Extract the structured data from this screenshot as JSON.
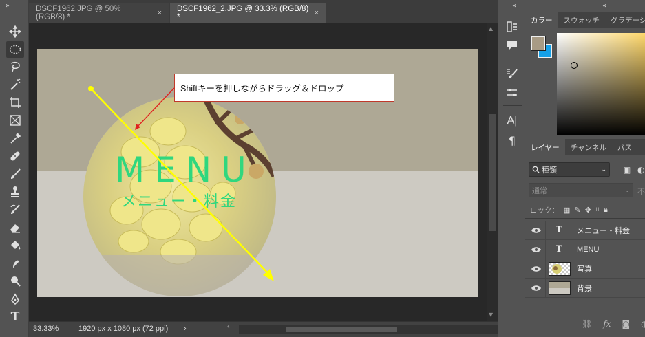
{
  "app": {
    "tabs": [
      {
        "label": "DSCF1962.JPG @ 50% (RGB/8) *",
        "close": "×"
      },
      {
        "label": "DSCF1962_2.JPG @ 33.3% (RGB/8) *",
        "close": "×"
      }
    ]
  },
  "toolbar": {
    "tools": [
      "move-tool-icon",
      "elliptical-marquee-icon",
      "lasso-icon",
      "magic-wand-icon",
      "crop-icon",
      "frame-icon",
      "eyedropper-icon",
      "healing-brush-icon",
      "brush-icon",
      "clone-stamp-icon",
      "history-brush-icon",
      "eraser-icon",
      "paint-bucket-icon",
      "smudge-icon",
      "dodge-icon",
      "pen-icon",
      "type-icon"
    ],
    "type_glyph": "T"
  },
  "canvas": {
    "menu_text": "MENU",
    "sub_text": "メニュー・料金",
    "text_color": "#2fd77e",
    "background_top": "#aea895",
    "background_bottom": "#cdcac2"
  },
  "callout": {
    "text": "Shiftキーを押しながらドラッグ＆ドロップ"
  },
  "status": {
    "zoom": "33.33%",
    "doc_info": "1920 px x 1080 px (72 ppi)",
    "arrow": "›",
    "scroll_left": "‹"
  },
  "midstrip": {
    "text_icon": "A|",
    "para_icon": "¶"
  },
  "color_panel": {
    "tabs": [
      "カラー",
      "スウォッチ",
      "グラデーション"
    ],
    "foreground": "#a89b85",
    "background": "#15a0e8"
  },
  "layers_panel": {
    "tabs": [
      "レイヤー",
      "チャンネル",
      "パス"
    ],
    "filter_label": "種類",
    "blend_mode": "通常",
    "opacity_label": "不",
    "lock_label": "ロック：",
    "layers": [
      {
        "name": "メニュー・料金",
        "kind": "text",
        "type_glyph": "T"
      },
      {
        "name": "MENU",
        "kind": "text",
        "type_glyph": "T"
      },
      {
        "name": "写真",
        "kind": "image"
      },
      {
        "name": "背景",
        "kind": "image"
      }
    ],
    "footer_icons": [
      "link-icon",
      "fx-icon",
      "mask-icon"
    ],
    "fx_label": "fx"
  }
}
